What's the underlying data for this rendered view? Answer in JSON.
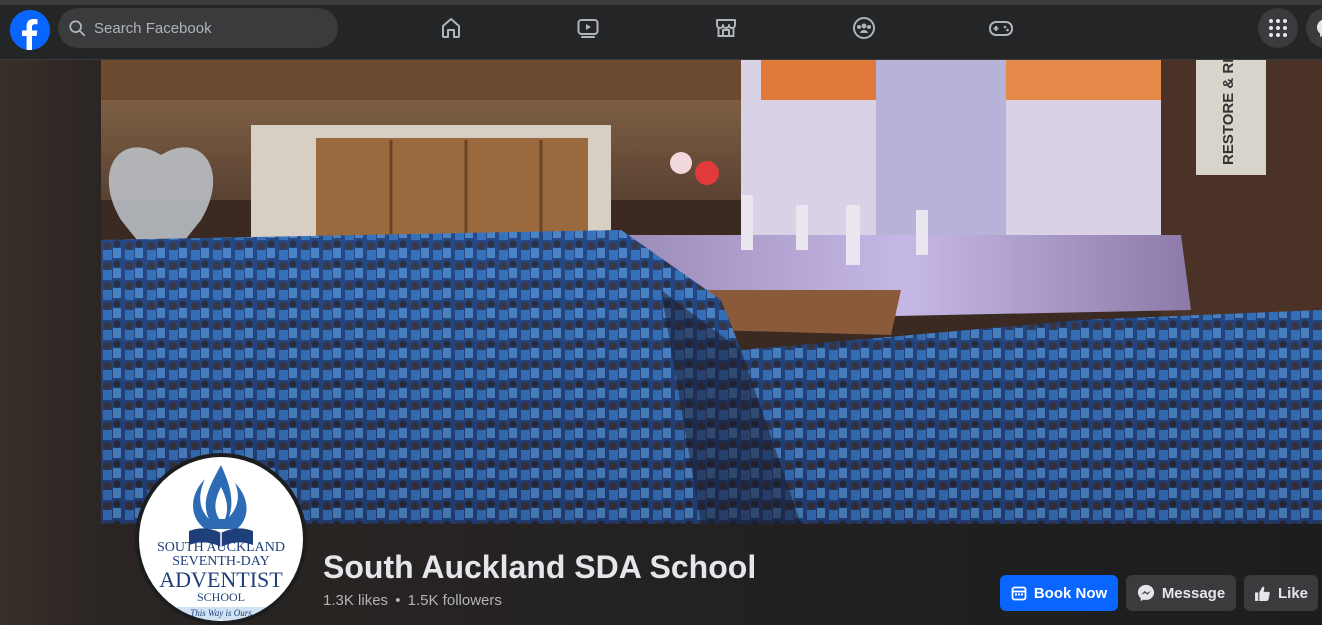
{
  "topbar": {
    "logo": "facebook-logo",
    "search_placeholder": "Search Facebook",
    "nav": [
      "home-icon",
      "video-icon",
      "marketplace-icon",
      "groups-icon",
      "gaming-icon"
    ],
    "right": [
      "menu-grid-icon",
      "messenger-icon"
    ]
  },
  "cover": {
    "banner_text": "RESTORE & RECLAIM"
  },
  "profile": {
    "logo_lines": [
      "SOUTH AUCKLAND",
      "SEVENTH-DAY",
      "ADVENTIST",
      "SCHOOL"
    ],
    "logo_tagline": "This Way is Ours",
    "name": "South Auckland SDA School",
    "likes": "1.3K likes",
    "separator": "•",
    "followers": "1.5K followers"
  },
  "actions": {
    "book_now": "Book Now",
    "message": "Message",
    "like": "Like"
  },
  "colors": {
    "accent": "#0866ff",
    "topbar_bg": "#242526",
    "page_bg": "#1c1d1f",
    "button_secondary": "#3a3b3c"
  }
}
